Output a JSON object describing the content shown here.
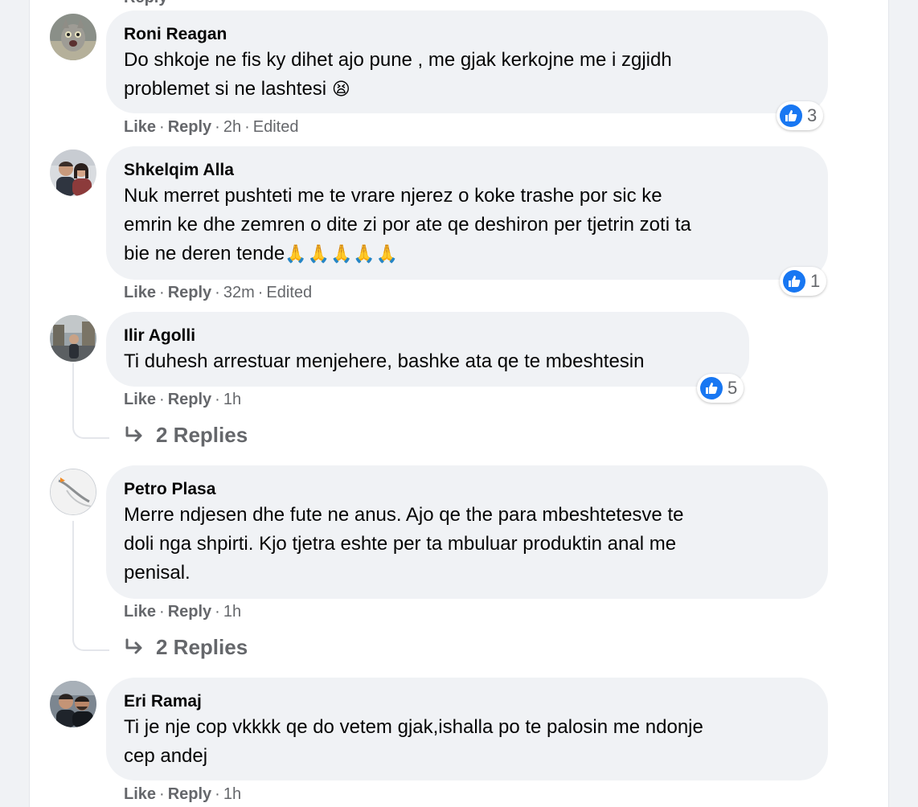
{
  "colors": {
    "bubble_bg": "#f0f2f5",
    "like_blue": "#1877f2",
    "meta_gray": "#65676b",
    "text": "#050505"
  },
  "top_fragment": "Reply",
  "comments": [
    {
      "author": "Roni Reagan",
      "lines": [
        "Do shkoje ne fis ky dihet ajo pune , me gjak kerkojne me i zgjidh",
        "problemet si ne lashtesi"
      ],
      "emoji": "😫",
      "like_label": "Like",
      "reply_label": "Reply",
      "time": "2h",
      "edited": "Edited",
      "reaction_count": "3",
      "avatar_icon": "cat-avatar-icon"
    },
    {
      "author": "Shkelqim Alla",
      "lines": [
        "Nuk merret pushteti me te vrare njerez o koke trashe por sic ke",
        "emrin ke dhe zemren o dite zi por ate qe deshiron per tjetrin zoti ta",
        "bie ne deren tende"
      ],
      "emoji": "🙏🙏🙏🙏🙏",
      "like_label": "Like",
      "reply_label": "Reply",
      "time": "32m",
      "edited": "Edited",
      "reaction_count": "1",
      "avatar_icon": "couple-avatar-icon"
    },
    {
      "author": "Ilir Agolli",
      "lines": [
        "Ti duhesh arrestuar menjehere, bashke ata qe te mbeshtesin"
      ],
      "like_label": "Like",
      "reply_label": "Reply",
      "time": "1h",
      "reaction_count": "5",
      "replies_label": "2 Replies",
      "avatar_icon": "city-avatar-icon"
    },
    {
      "author": "Petro Plasa",
      "lines": [
        "Merre ndjesen dhe fute ne anus. Ajo qe the para mbeshtetesve te",
        "doli nga shpirti. Kjo tjetra eshte per ta mbuluar produktin anal me",
        "penisal."
      ],
      "like_label": "Like",
      "reply_label": "Reply",
      "time": "1h",
      "replies_label": "2 Replies",
      "avatar_icon": "bird-avatar-icon"
    },
    {
      "author": "Eri Ramaj",
      "lines": [
        "Ti je nje cop vkkkk qe do vetem gjak,ishalla po te palosin me ndonje",
        "cep andej"
      ],
      "like_label": "Like",
      "reply_label": "Reply",
      "time": "1h",
      "avatar_icon": "two-men-avatar-icon"
    }
  ]
}
